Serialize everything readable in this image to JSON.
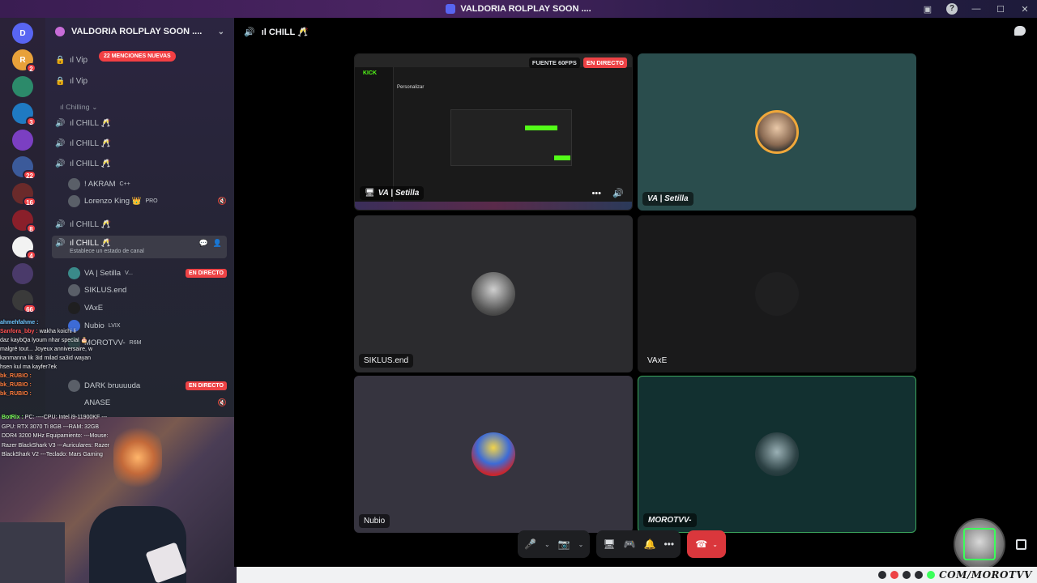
{
  "window": {
    "title": "VALDORIA ROLPLAY SOON ...."
  },
  "servers": [
    {
      "label": "D",
      "badge": ""
    },
    {
      "label": "R",
      "badge": "2"
    },
    {
      "label": "",
      "badge": ""
    },
    {
      "label": "",
      "badge": "3"
    },
    {
      "label": "",
      "badge": ""
    },
    {
      "label": "",
      "badge": "22"
    },
    {
      "label": "",
      "badge": "16"
    },
    {
      "label": "",
      "badge": "8"
    },
    {
      "label": "",
      "badge": "4"
    },
    {
      "label": "",
      "badge": ""
    },
    {
      "label": "",
      "badge": "66"
    }
  ],
  "sidebar": {
    "guild_name": "VALDORIA ROLPLAY SOON ....",
    "mentions_pill": "22 MENCIONES NUEVAS",
    "locked_channel_1": "ıl Vip",
    "locked_channel_2": "ıl Vip",
    "category": "ıl Chilling",
    "chill_label": "ıl CHILL 🥂",
    "active_channel": "ıl CHILL 🥂",
    "active_status": "Establece un estado de canal",
    "live_label": "EN DIRECTO",
    "users_chill3": [
      {
        "name": "! AKRAM",
        "tag": "C++"
      },
      {
        "name": "Lorenzo King 👑",
        "tag": "PRO"
      }
    ],
    "users_active": [
      {
        "name": "VA | Setilla",
        "tag": "V..."
      },
      {
        "name": "SIKLUS.end",
        "tag": ""
      },
      {
        "name": "VAxE",
        "tag": ""
      },
      {
        "name": "Nubio",
        "tag": "LVIX"
      },
      {
        "name": "MOROTVV-",
        "tag": "R6M"
      }
    ],
    "users_last": [
      {
        "name": "DARK bruuuuda",
        "tag": ""
      },
      {
        "name": "ANASE",
        "tag": ""
      }
    ]
  },
  "overlay_chat": {
    "lines": [
      {
        "user": "ahmehfahme :",
        "text": "",
        "color": "u-blue"
      },
      {
        "user": "Sanfora_bby :",
        "text": "wakha koichi li",
        "color": "u-red"
      },
      {
        "user": "",
        "text": "daz kaybQa lyoum nhar special 🎂",
        "color": ""
      },
      {
        "user": "",
        "text": "malgré tout... Joyeux anniversaire, w",
        "color": ""
      },
      {
        "user": "",
        "text": "kanmanna lik 3id milad sa3id wayan",
        "color": ""
      },
      {
        "user": "",
        "text": "hsen kul ma kayfer7ek",
        "color": ""
      },
      {
        "user": "bk_RUBIO :",
        "text": "",
        "color": "u-orange"
      },
      {
        "user": "bk_RUBIO :",
        "text": "",
        "color": "u-orange"
      },
      {
        "user": "bk_RUBIO :",
        "text": "",
        "color": "u-orange"
      }
    ]
  },
  "overlay_specs": {
    "bot": "BotRix :",
    "text": "PC: ----CPU: Intel i9-11900KF ---GPU: RTX 3070 Ti 8GB ---RAM: 32GB DDR4 3200 MHz Equipamiento: ---Mouse: Razer BlackShark V3 ---Auriculares: Razer BlackShark V2 ---Teclado: Mars Gaming"
  },
  "voice": {
    "header": "ıl CHILL 🥂",
    "stream": {
      "quality": "FUENTE 60FPS",
      "live": "EN DIRECTO",
      "name": "VA | Setilla",
      "app_logo": "KICK",
      "app_heading": "Personalizar"
    },
    "tiles": {
      "setilla": "VA | Setilla",
      "siklus": "SIKLUS.end",
      "vaxe": "VAxE",
      "nubio": "Nubio",
      "moro": "MOROTVV-"
    }
  },
  "watermark": {
    "url": "COM/MOROTVV"
  },
  "colors": {
    "accent": "#5865f2",
    "danger": "#da373c",
    "live": "#ed4245",
    "speaking": "#3ba55d",
    "kick": "#53fc18"
  },
  "icons": [
    "discord-icon",
    "speaker-icon",
    "lock-icon",
    "mic-icon",
    "camera-icon",
    "screen-share-icon",
    "activity-icon",
    "soundboard-icon",
    "more-icon",
    "hangup-icon",
    "chat-icon",
    "fullscreen-icon",
    "help-icon"
  ]
}
